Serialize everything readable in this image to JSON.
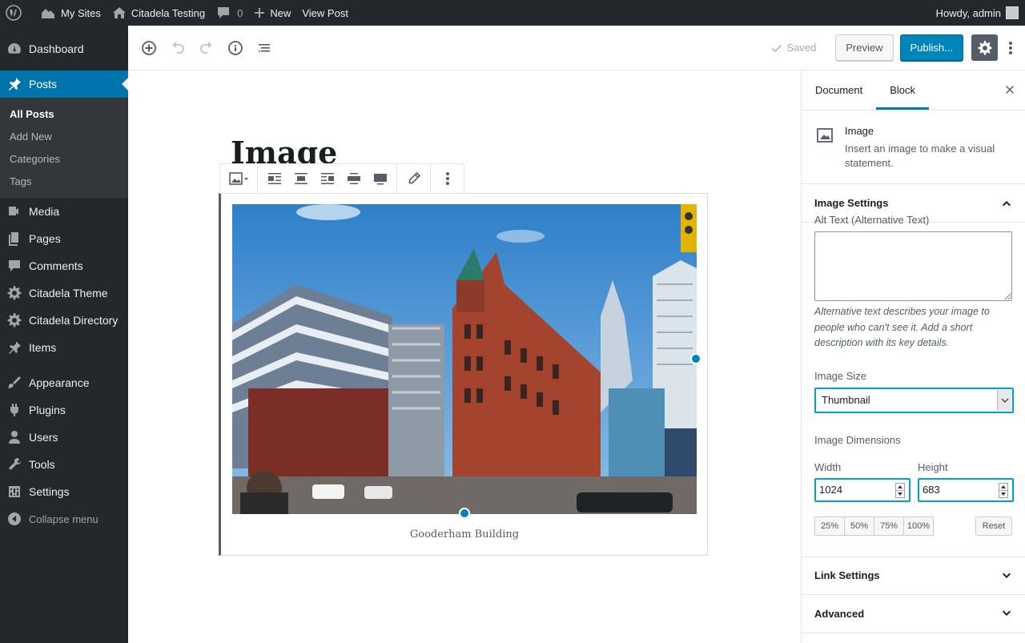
{
  "admin_bar": {
    "my_sites": "My Sites",
    "site_name": "Citadela Testing",
    "comments_count": "0",
    "new_label": "New",
    "view_post": "View Post",
    "greeting": "Howdy, admin"
  },
  "sidebar": {
    "items": [
      {
        "label": "Dashboard",
        "icon": "dashboard-icon"
      },
      {
        "label": "Posts",
        "icon": "pin-icon",
        "active": true
      },
      {
        "label": "Media",
        "icon": "media-icon"
      },
      {
        "label": "Pages",
        "icon": "pages-icon"
      },
      {
        "label": "Comments",
        "icon": "comment-icon"
      },
      {
        "label": "Citadela Theme",
        "icon": "gear-icon"
      },
      {
        "label": "Citadela Directory",
        "icon": "gear-icon"
      },
      {
        "label": "Items",
        "icon": "pin-icon"
      },
      {
        "label": "Appearance",
        "icon": "brush-icon"
      },
      {
        "label": "Plugins",
        "icon": "plugin-icon"
      },
      {
        "label": "Users",
        "icon": "user-icon"
      },
      {
        "label": "Tools",
        "icon": "wrench-icon"
      },
      {
        "label": "Settings",
        "icon": "settings-icon"
      }
    ],
    "submenu": [
      "All Posts",
      "Add New",
      "Categories",
      "Tags"
    ],
    "collapse": "Collapse menu"
  },
  "header": {
    "saved": "Saved",
    "preview": "Preview",
    "publish": "Publish..."
  },
  "post": {
    "title": "Image",
    "caption": "Gooderham Building"
  },
  "settings": {
    "tabs": [
      "Document",
      "Block"
    ],
    "block_card": {
      "title": "Image",
      "description": "Insert an image to make a visual statement."
    },
    "image_settings": {
      "title": "Image Settings",
      "alt_label": "Alt Text (Alternative Text)",
      "alt_value": "",
      "alt_help": "Alternative text describes your image to people who can't see it. Add a short description with its key details.",
      "size_label": "Image Size",
      "size_value": "Thumbnail",
      "dims_label": "Image Dimensions",
      "width_label": "Width",
      "width_value": "1024",
      "height_label": "Height",
      "height_value": "683",
      "percents": [
        "25%",
        "50%",
        "75%",
        "100%"
      ],
      "reset": "Reset"
    },
    "link_settings": "Link Settings",
    "advanced": "Advanced"
  },
  "colors": {
    "admin_bg": "#23282d",
    "accent": "#0073aa",
    "publish": "#0085ba",
    "focus": "#00a0d2"
  }
}
